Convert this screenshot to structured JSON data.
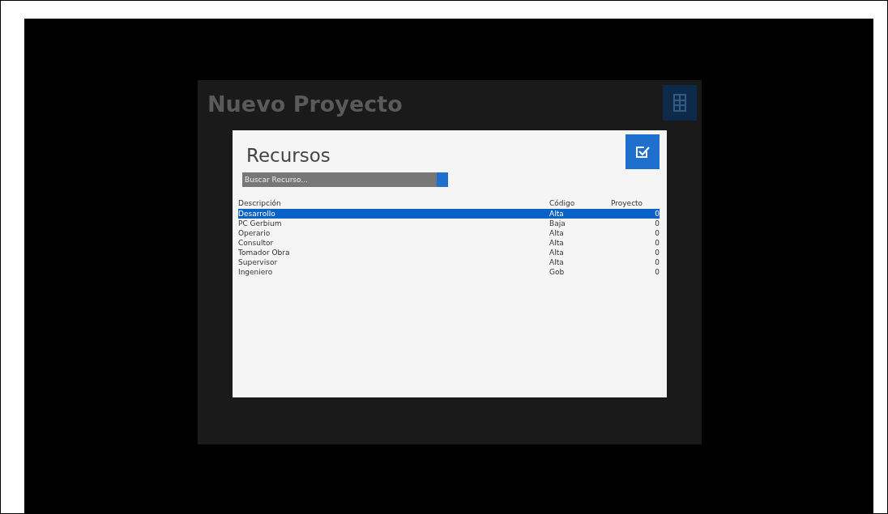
{
  "background_window": {
    "title": "Nuevo Proyecto"
  },
  "dialog": {
    "title": "Recursos",
    "search": {
      "placeholder": "Buscar Recurso..."
    },
    "table": {
      "columns": [
        "Descripción",
        "Código",
        "Proyecto"
      ],
      "rows": [
        {
          "cells": [
            "Desarrollo",
            "Alta",
            "0"
          ],
          "selected": true
        },
        {
          "cells": [
            "PC Gerbium",
            "Baja",
            "0"
          ],
          "selected": false
        },
        {
          "cells": [
            "Operario",
            "Alta",
            "0"
          ],
          "selected": false
        },
        {
          "cells": [
            "Consultor",
            "Alta",
            "0"
          ],
          "selected": false
        },
        {
          "cells": [
            "Tomador Obra",
            "Alta",
            "0"
          ],
          "selected": false
        },
        {
          "cells": [
            "Supervisor",
            "Alta",
            "0"
          ],
          "selected": false
        },
        {
          "cells": [
            "Ingeniero",
            "Gob",
            "0"
          ],
          "selected": false
        }
      ]
    }
  }
}
